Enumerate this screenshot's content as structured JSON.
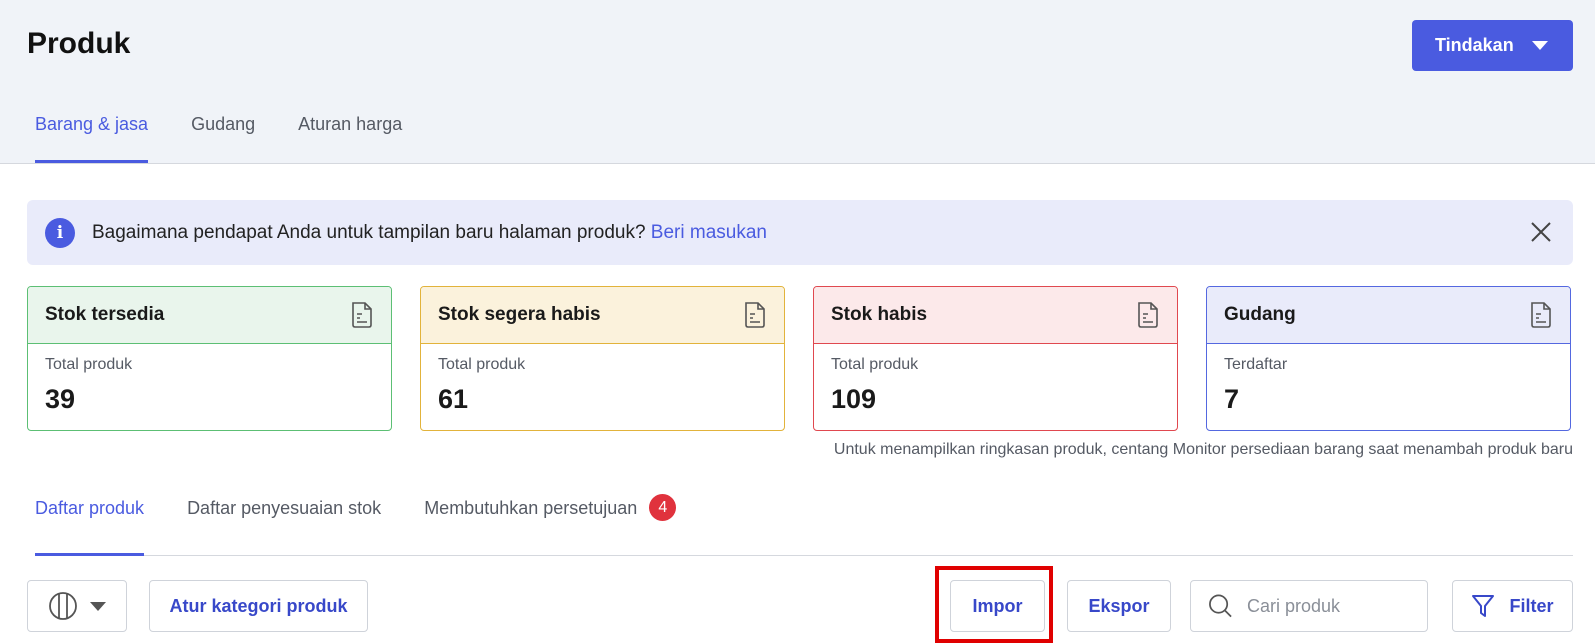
{
  "header": {
    "title": "Produk",
    "action_label": "Tindakan"
  },
  "top_tabs": [
    {
      "label": "Barang & jasa",
      "active": true
    },
    {
      "label": "Gudang",
      "active": false
    },
    {
      "label": "Aturan harga",
      "active": false
    }
  ],
  "info_banner": {
    "text": "Bagaimana pendapat Anda untuk tampilan baru halaman produk?",
    "link": "Beri masukan",
    "icon": "info-icon",
    "close_icon": "close-icon"
  },
  "cards": [
    {
      "title": "Stok tersedia",
      "label": "Total produk",
      "value": "39",
      "border": "#5cbf74",
      "head_bg": "#e9f5ec"
    },
    {
      "title": "Stok segera habis",
      "label": "Total produk",
      "value": "61",
      "border": "#e2b33b",
      "head_bg": "#fbf2dc"
    },
    {
      "title": "Stok habis",
      "label": "Total produk",
      "value": "109",
      "border": "#e0484f",
      "head_bg": "#fce9ea"
    },
    {
      "title": "Gudang",
      "label": "Terdaftar",
      "value": "7",
      "border": "#5468e0",
      "head_bg": "#e9ebfa"
    }
  ],
  "summary_note": "Untuk menampilkan ringkasan produk, centang Monitor persediaan barang saat menambah produk baru",
  "list_tabs": [
    {
      "label": "Daftar produk",
      "active": true
    },
    {
      "label": "Daftar penyesuaian stok",
      "active": false
    },
    {
      "label": "Membutuhkan persetujuan",
      "active": false,
      "badge": "4"
    }
  ],
  "toolbar": {
    "column_toggle_icon": "columns-icon",
    "category_button": "Atur kategori produk",
    "import_button": "Impor",
    "export_button": "Ekspor",
    "search_placeholder": "Cari produk",
    "filter_button": "Filter"
  },
  "colors": {
    "accent": "#4a5be0",
    "badge": "#e0323d",
    "highlight": "#e00000"
  }
}
